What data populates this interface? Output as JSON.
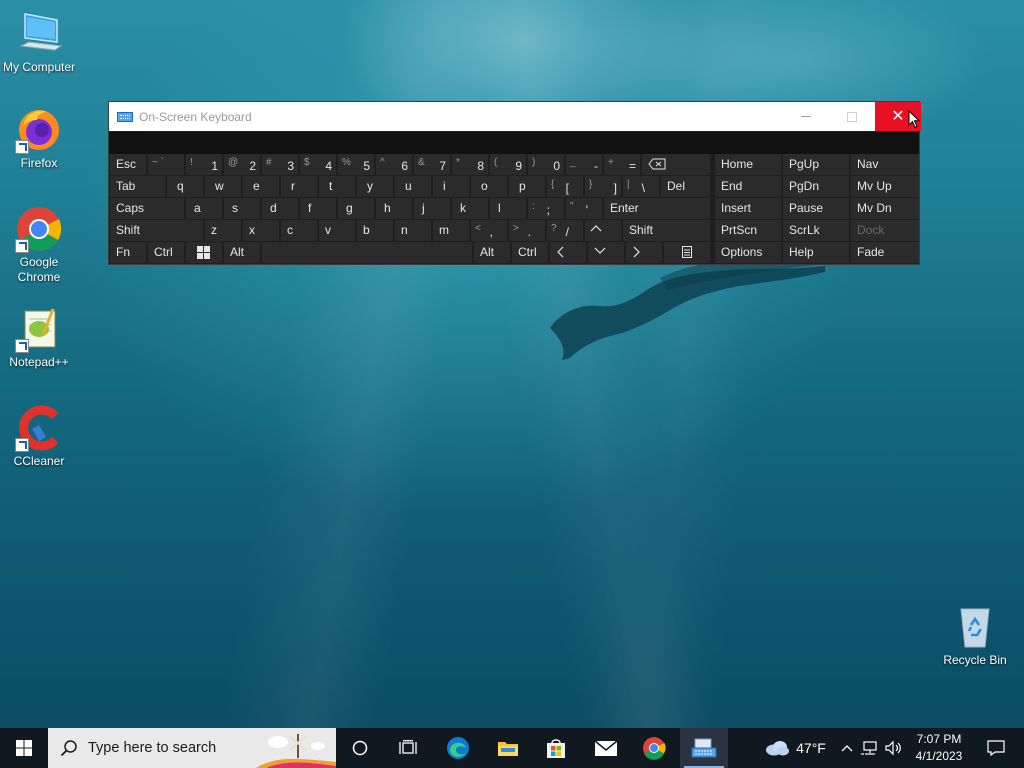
{
  "desktop": {
    "icons": [
      {
        "label": "My Computer"
      },
      {
        "label": "Firefox"
      },
      {
        "label": "Google Chrome"
      },
      {
        "label": "Notepad++"
      },
      {
        "label": "CCleaner"
      },
      {
        "label": "Recycle Bin"
      }
    ]
  },
  "osk": {
    "title": "On-Screen Keyboard",
    "close_glyph": "✕",
    "rows": {
      "r1": [
        {
          "label": "Esc"
        },
        {
          "top": "~ `",
          "main": ""
        },
        {
          "top": "!",
          "main": "1"
        },
        {
          "top": "@",
          "main": "2"
        },
        {
          "top": "#",
          "main": "3"
        },
        {
          "top": "$",
          "main": "4"
        },
        {
          "top": "%",
          "main": "5"
        },
        {
          "top": "^",
          "main": "6"
        },
        {
          "top": "&",
          "main": "7"
        },
        {
          "top": "*",
          "main": "8"
        },
        {
          "top": "(",
          "main": "9"
        },
        {
          "top": ")",
          "main": "0"
        },
        {
          "top": "_",
          "main": "-"
        },
        {
          "top": "+",
          "main": "="
        }
      ],
      "r2": [
        {
          "label": "Tab"
        },
        {
          "label": "q"
        },
        {
          "label": "w"
        },
        {
          "label": "e"
        },
        {
          "label": "r"
        },
        {
          "label": "t"
        },
        {
          "label": "y"
        },
        {
          "label": "u"
        },
        {
          "label": "i"
        },
        {
          "label": "o"
        },
        {
          "label": "p"
        },
        {
          "top": "{",
          "main": "["
        },
        {
          "top": "}",
          "main": "]"
        },
        {
          "top": "|",
          "main": "\\"
        },
        {
          "label": "Del"
        }
      ],
      "r3": [
        {
          "label": "Caps"
        },
        {
          "label": "a"
        },
        {
          "label": "s"
        },
        {
          "label": "d"
        },
        {
          "label": "f"
        },
        {
          "label": "g"
        },
        {
          "label": "h"
        },
        {
          "label": "j"
        },
        {
          "label": "k"
        },
        {
          "label": "l"
        },
        {
          "top": ":",
          "main": ";"
        },
        {
          "top": "\"",
          "main": "'"
        },
        {
          "label": "Enter"
        }
      ],
      "r4": [
        {
          "label": "Shift"
        },
        {
          "label": "z"
        },
        {
          "label": "x"
        },
        {
          "label": "c"
        },
        {
          "label": "v"
        },
        {
          "label": "b"
        },
        {
          "label": "n"
        },
        {
          "label": "m"
        },
        {
          "top": "<",
          "main": ","
        },
        {
          "top": ">",
          "main": "."
        },
        {
          "top": "?",
          "main": "/"
        },
        {
          "label": "Shift"
        }
      ],
      "r5": [
        {
          "label": "Fn"
        },
        {
          "label": "Ctrl"
        },
        {
          "label": "Alt"
        },
        {
          "label": "Alt"
        },
        {
          "label": "Ctrl"
        }
      ]
    },
    "nav_keys": [
      [
        "Home",
        "PgUp",
        "Nav"
      ],
      [
        "End",
        "PgDn",
        "Mv Up"
      ],
      [
        "Insert",
        "Pause",
        "Mv Dn"
      ],
      [
        "PrtScn",
        "ScrLk",
        "Dock"
      ],
      [
        "Options",
        "Help",
        "Fade"
      ]
    ]
  },
  "taskbar": {
    "search_placeholder": "Type here to search",
    "weather_temp": "47°F",
    "time": "7:07 PM",
    "date": "4/1/2023"
  }
}
